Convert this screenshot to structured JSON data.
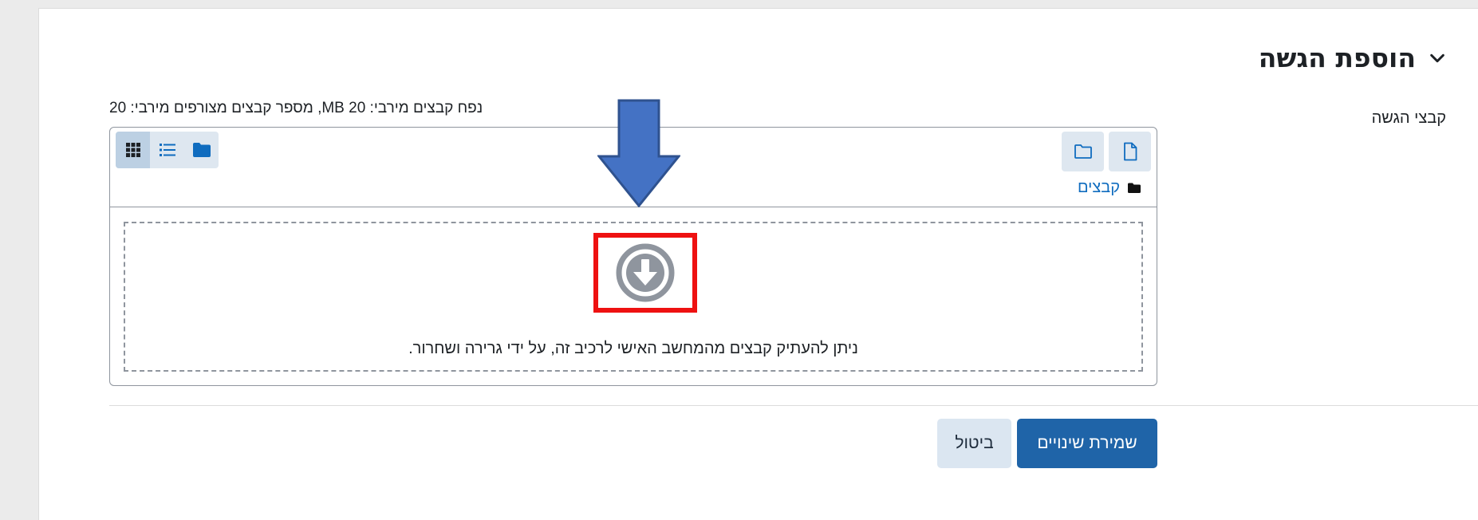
{
  "section": {
    "title": "הוספת הגשה",
    "toggle_icon": "chevron-down-icon"
  },
  "field": {
    "label": "קבצי הגשה"
  },
  "filemanager": {
    "limits": "נפח קבצים מירבי: 20 MB, מספר קבצים מצורפים מירבי: 20",
    "actions": [
      {
        "name": "add-file",
        "icon": "file-icon"
      },
      {
        "name": "create-folder",
        "icon": "folder-outline-icon"
      }
    ],
    "views": [
      {
        "name": "icons-view",
        "icon": "grid-icon",
        "active": true
      },
      {
        "name": "list-view",
        "icon": "list-icon",
        "active": false
      },
      {
        "name": "tree-view",
        "icon": "folder-icon",
        "active": false
      }
    ],
    "path": {
      "label": "קבצים",
      "icon": "folder-icon"
    },
    "dropzone": {
      "text": "ניתן להעתיק קבצים מהמחשב האישי לרכיב זה, על ידי גרירה ושחרור.",
      "icon": "download-circle-icon"
    }
  },
  "annotations": {
    "arrow_color": "#4472c4",
    "highlight_color": "#ee1111"
  },
  "buttons": {
    "save": "שמירת שינויים",
    "cancel": "ביטול"
  }
}
